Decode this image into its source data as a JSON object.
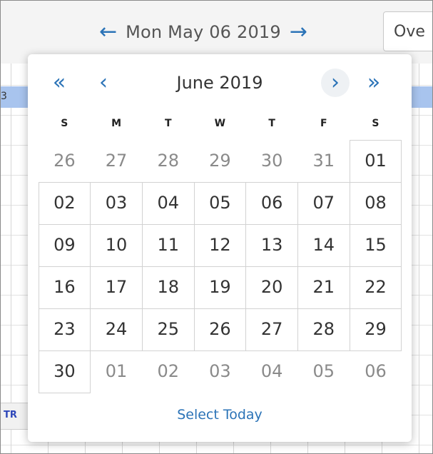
{
  "topbar": {
    "prev_label": "←",
    "date_label": "Mon May 06 2019",
    "next_label": "→",
    "view_button_label": "Ove"
  },
  "background": {
    "header_label": "3",
    "event_label": "TR"
  },
  "datepicker": {
    "prev_year_label": "«",
    "prev_month_label": "‹",
    "title": "June 2019",
    "next_month_label": "›",
    "next_year_label": "»",
    "weekdays": [
      "S",
      "M",
      "T",
      "W",
      "T",
      "F",
      "S"
    ],
    "days": [
      {
        "label": "26",
        "other": true
      },
      {
        "label": "27",
        "other": true
      },
      {
        "label": "28",
        "other": true
      },
      {
        "label": "29",
        "other": true
      },
      {
        "label": "30",
        "other": true
      },
      {
        "label": "31",
        "other": true
      },
      {
        "label": "01",
        "other": false
      },
      {
        "label": "02",
        "other": false
      },
      {
        "label": "03",
        "other": false
      },
      {
        "label": "04",
        "other": false
      },
      {
        "label": "05",
        "other": false
      },
      {
        "label": "06",
        "other": false
      },
      {
        "label": "07",
        "other": false
      },
      {
        "label": "08",
        "other": false
      },
      {
        "label": "09",
        "other": false
      },
      {
        "label": "10",
        "other": false
      },
      {
        "label": "11",
        "other": false
      },
      {
        "label": "12",
        "other": false
      },
      {
        "label": "13",
        "other": false
      },
      {
        "label": "14",
        "other": false
      },
      {
        "label": "15",
        "other": false
      },
      {
        "label": "16",
        "other": false
      },
      {
        "label": "17",
        "other": false
      },
      {
        "label": "18",
        "other": false
      },
      {
        "label": "19",
        "other": false
      },
      {
        "label": "20",
        "other": false
      },
      {
        "label": "21",
        "other": false
      },
      {
        "label": "22",
        "other": false
      },
      {
        "label": "23",
        "other": false
      },
      {
        "label": "24",
        "other": false
      },
      {
        "label": "25",
        "other": false
      },
      {
        "label": "26",
        "other": false
      },
      {
        "label": "27",
        "other": false
      },
      {
        "label": "28",
        "other": false
      },
      {
        "label": "29",
        "other": false
      },
      {
        "label": "30",
        "other": false
      },
      {
        "label": "01",
        "other": true
      },
      {
        "label": "02",
        "other": true
      },
      {
        "label": "03",
        "other": true
      },
      {
        "label": "04",
        "other": true
      },
      {
        "label": "05",
        "other": true
      },
      {
        "label": "06",
        "other": true
      }
    ],
    "footer_label": "Select Today"
  },
  "colors": {
    "accent": "#2b73b7",
    "grid_header": "#a8c4ee",
    "event_text": "#2d46b9"
  }
}
